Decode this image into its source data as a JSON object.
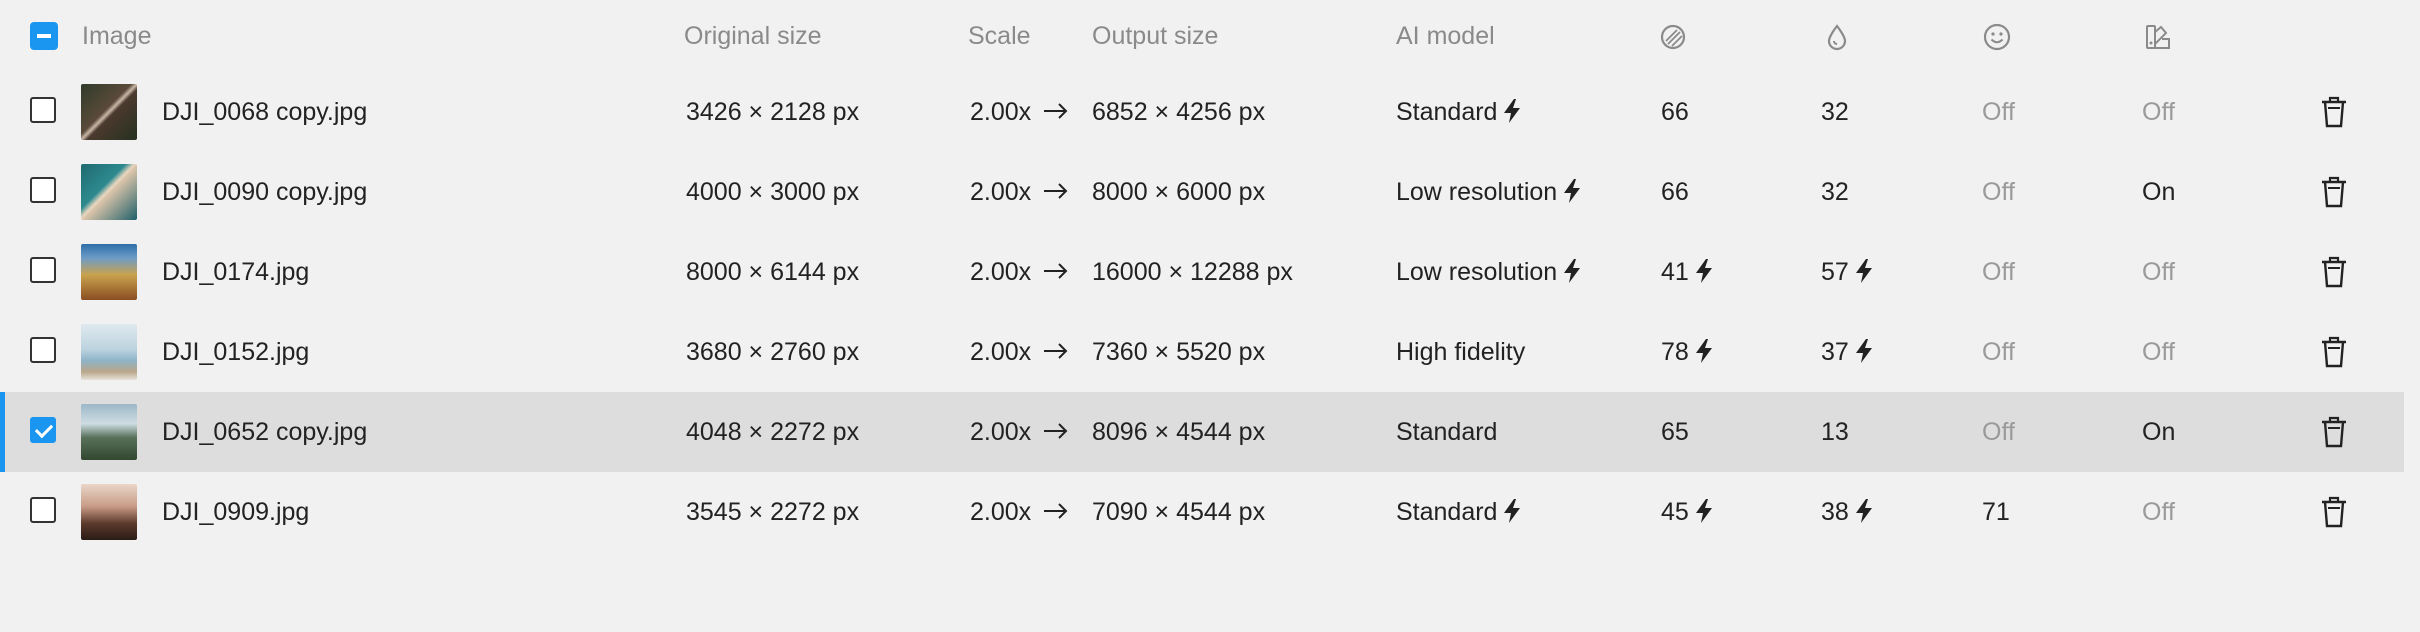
{
  "header": {
    "image": "Image",
    "original_size": "Original size",
    "scale": "Scale",
    "output_size": "Output size",
    "ai_model": "AI model",
    "icons": [
      "noise-icon",
      "water-drop-icon",
      "face-icon",
      "color-palette-icon"
    ]
  },
  "rows": [
    {
      "name": "DJI_0068 copy.jpg",
      "original": "3426 × 2128 px",
      "scale": "2.00x",
      "output": "6852 × 4256 px",
      "model": "Standard",
      "model_bolt": true,
      "c1": "66",
      "c1_bolt": false,
      "c2": "32",
      "c2_bolt": false,
      "c3": "Off",
      "c4": "Off",
      "checked": false
    },
    {
      "name": "DJI_0090 copy.jpg",
      "original": "4000 × 3000 px",
      "scale": "2.00x",
      "output": "8000 × 6000 px",
      "model": "Low resolution",
      "model_bolt": true,
      "c1": "66",
      "c1_bolt": false,
      "c2": "32",
      "c2_bolt": false,
      "c3": "Off",
      "c4": "On",
      "checked": false
    },
    {
      "name": "DJI_0174.jpg",
      "original": "8000 × 6144 px",
      "scale": "2.00x",
      "output": "16000 × 12288 px",
      "model": "Low resolution",
      "model_bolt": true,
      "c1": "41",
      "c1_bolt": true,
      "c2": "57",
      "c2_bolt": true,
      "c3": "Off",
      "c4": "Off",
      "checked": false
    },
    {
      "name": "DJI_0152.jpg",
      "original": "3680 × 2760 px",
      "scale": "2.00x",
      "output": "7360 × 5520 px",
      "model": "High fidelity",
      "model_bolt": false,
      "c1": "78",
      "c1_bolt": true,
      "c2": "37",
      "c2_bolt": true,
      "c3": "Off",
      "c4": "Off",
      "checked": false
    },
    {
      "name": "DJI_0652 copy.jpg",
      "original": "4048 × 2272 px",
      "scale": "2.00x",
      "output": "8096 × 4544 px",
      "model": "Standard",
      "model_bolt": false,
      "c1": "65",
      "c1_bolt": false,
      "c2": "13",
      "c2_bolt": false,
      "c3": "Off",
      "c4": "On",
      "checked": true
    },
    {
      "name": "DJI_0909.jpg",
      "original": "3545 × 2272 px",
      "scale": "2.00x",
      "output": "7090 × 4544 px",
      "model": "Standard",
      "model_bolt": true,
      "c1": "45",
      "c1_bolt": true,
      "c2": "38",
      "c2_bolt": true,
      "c3": "71",
      "c4": "Off",
      "checked": false
    }
  ],
  "colors": {
    "accent": "#1a95f0",
    "selected_row": "#dddddd",
    "muted": "#9a9a9a"
  }
}
